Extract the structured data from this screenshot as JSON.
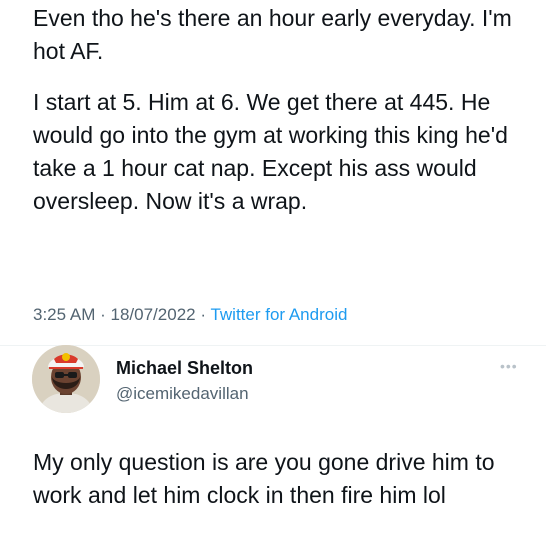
{
  "tweet": {
    "paragraph_1": "Even tho he's there an hour early everyday. I'm hot AF.",
    "paragraph_2": "I start at 5. Him at 6. We get there at 445. He would go into the gym at working this king he'd take a 1 hour cat nap. Except his ass would oversleep. Now it's a wrap.",
    "time": "3:25 AM",
    "separator": "·",
    "date": "18/07/2022",
    "source": "Twitter for Android"
  },
  "reply": {
    "name": "Michael Shelton",
    "handle": "@icemikedavillan",
    "text": "My only question is are you gone drive him to work and let him clock in then fire him lol"
  },
  "icons": {
    "more": "more-dots-icon",
    "avatar": "profile-photo"
  }
}
